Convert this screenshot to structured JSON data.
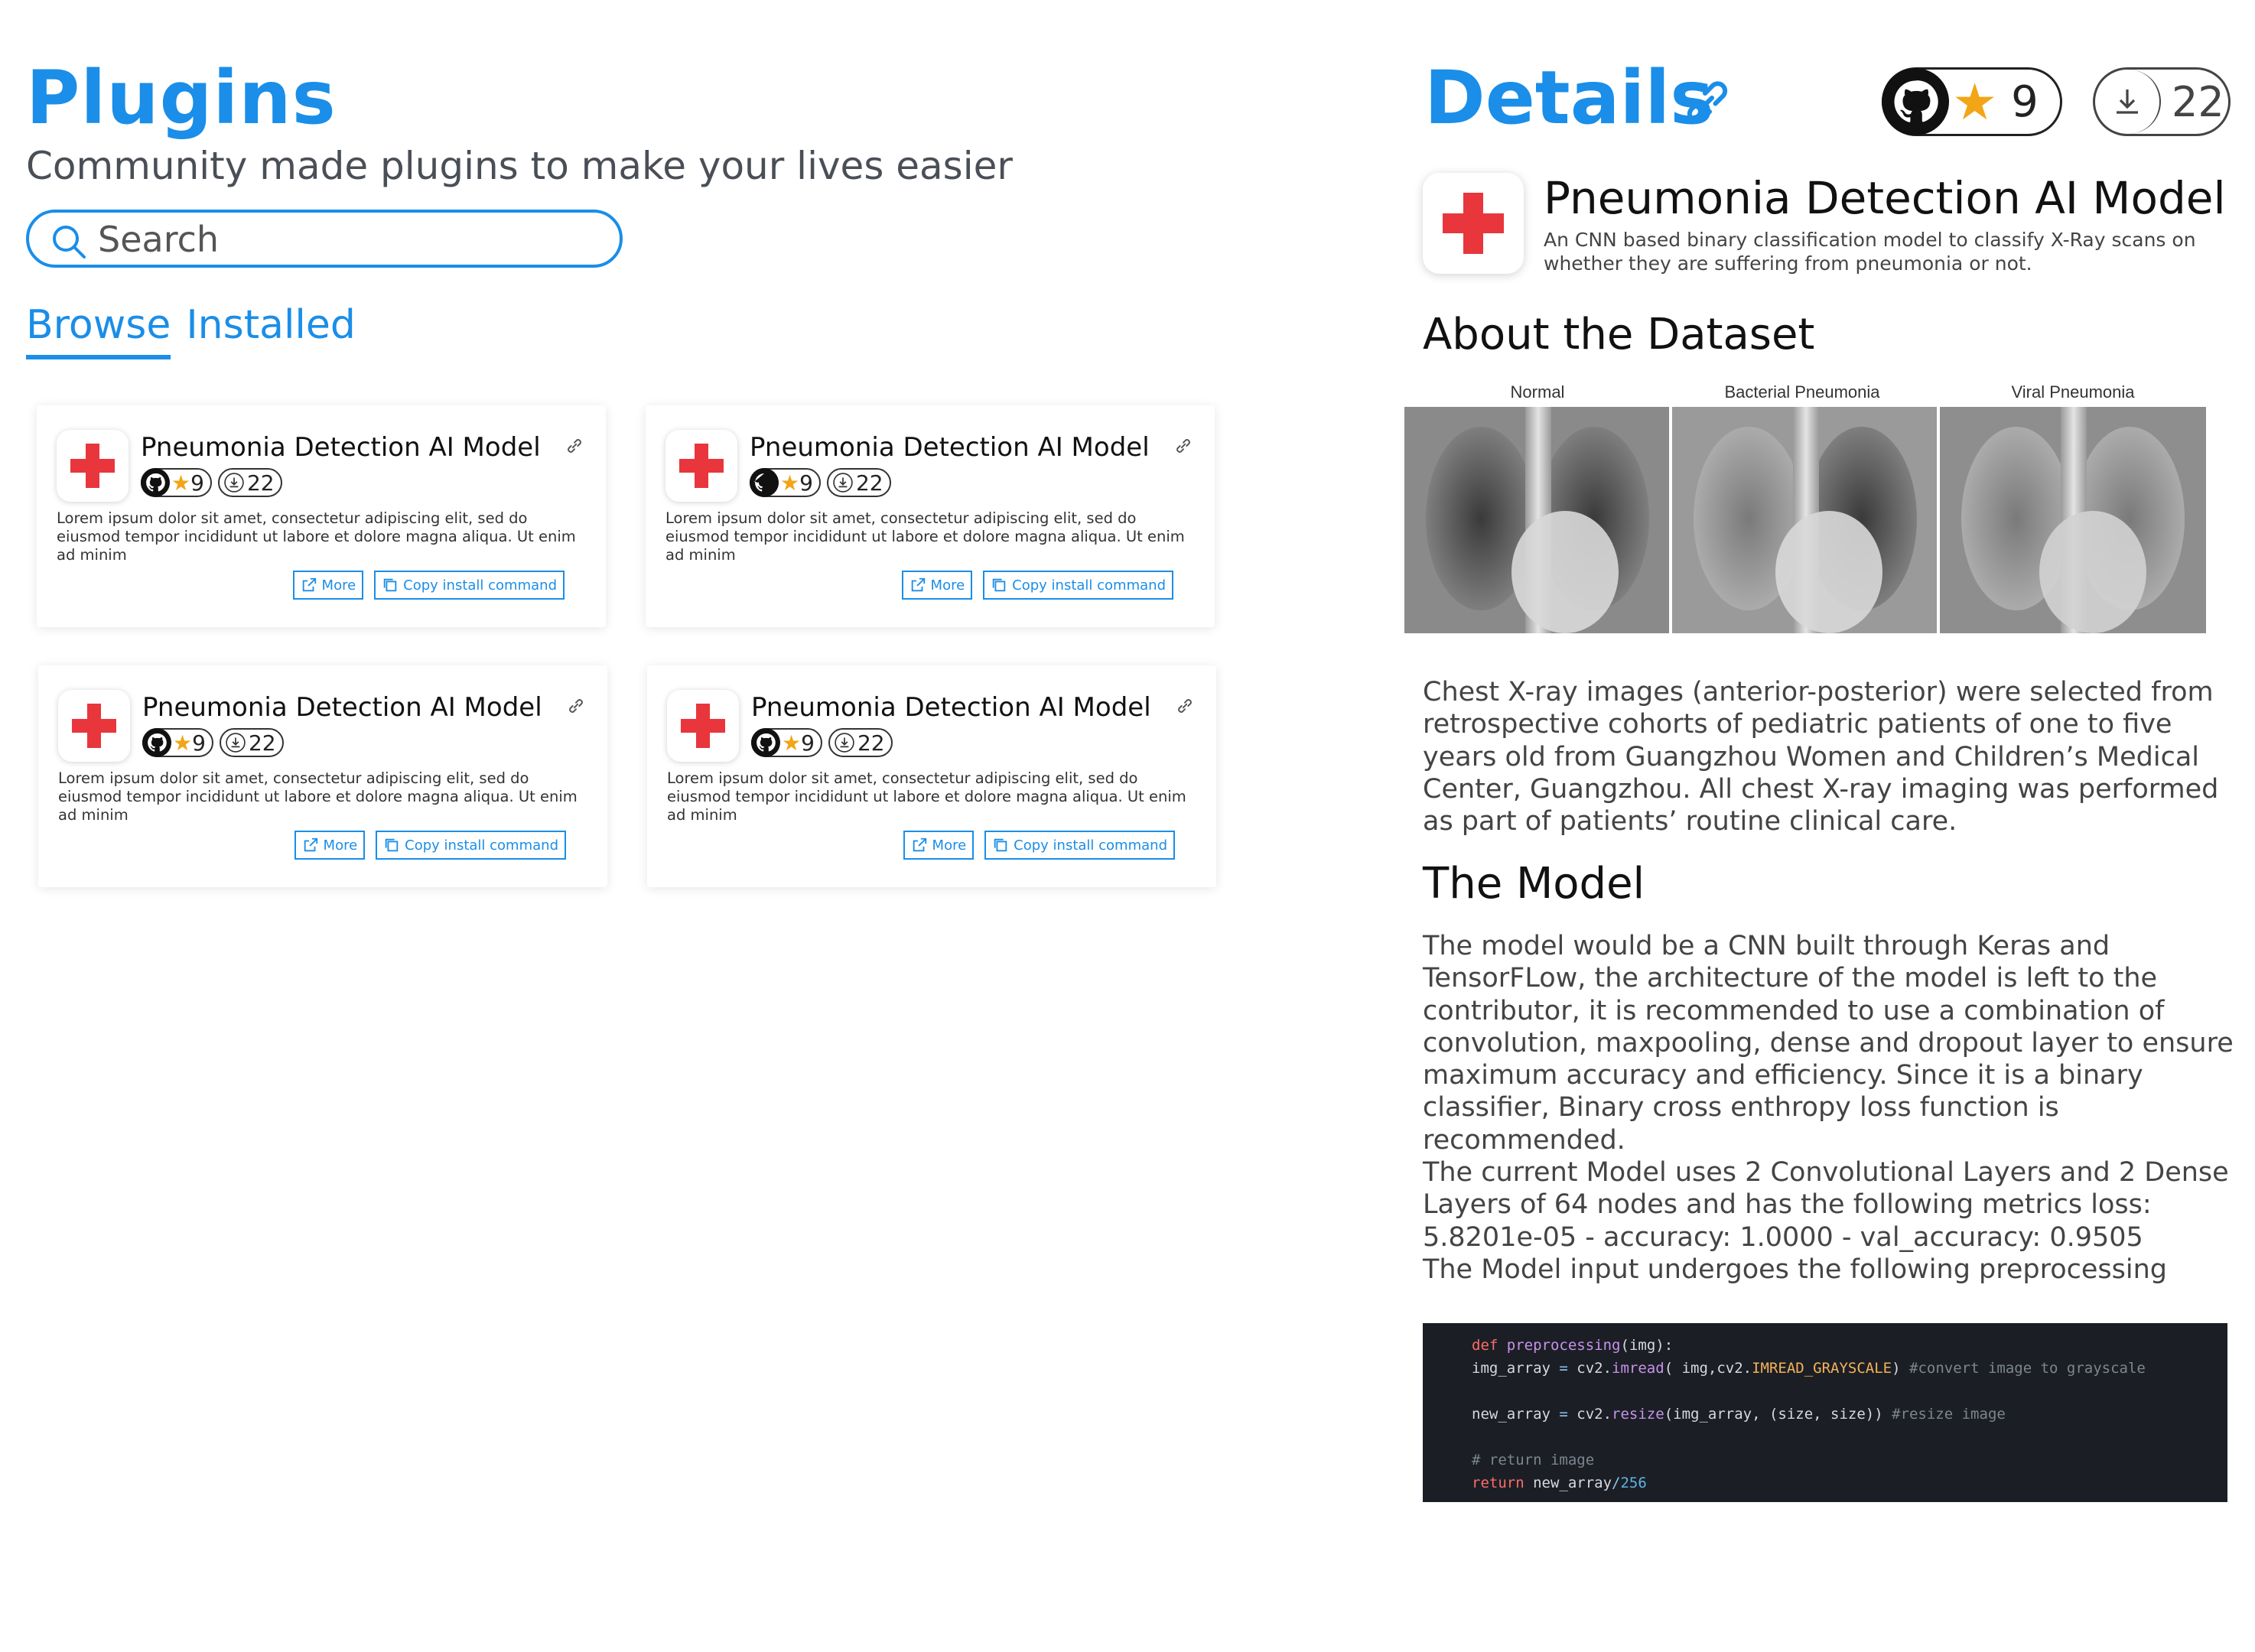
{
  "left": {
    "title": "Plugins",
    "subtitle": "Community made plugins to make your lives easier",
    "search": {
      "placeholder": "Search"
    },
    "tabs": [
      {
        "label": "Browse",
        "active": true
      },
      {
        "label": "Installed",
        "active": false
      }
    ],
    "cards": [
      {
        "title": "Pneumonia Detection AI Model",
        "stars": "9",
        "downloads": "22",
        "description": "Lorem ipsum dolor sit amet, consectetur adipiscing elit, sed do eiusmod tempor incididunt ut labore et dolore magna aliqua. Ut enim ad minim",
        "more_label": "More",
        "copy_label": "Copy install command"
      },
      {
        "title": "Pneumonia Detection AI Model",
        "stars": "9",
        "downloads": "22",
        "description": "Lorem ipsum dolor sit amet, consectetur adipiscing elit, sed do eiusmod tempor incididunt ut labore et dolore magna aliqua. Ut enim ad minim",
        "more_label": "More",
        "copy_label": "Copy install command"
      },
      {
        "title": "Pneumonia Detection AI Model",
        "stars": "9",
        "downloads": "22",
        "description": "Lorem ipsum dolor sit amet, consectetur adipiscing elit, sed do eiusmod tempor incididunt ut labore et dolore magna aliqua. Ut enim ad minim",
        "more_label": "More",
        "copy_label": "Copy install command"
      },
      {
        "title": "Pneumonia Detection AI Model",
        "stars": "9",
        "downloads": "22",
        "description": "Lorem ipsum dolor sit amet, consectetur adipiscing elit, sed do eiusmod tempor incididunt ut labore et dolore magna aliqua. Ut enim ad minim",
        "more_label": "More",
        "copy_label": "Copy install command"
      }
    ]
  },
  "details": {
    "title": "Details",
    "stars": "9",
    "downloads": "22",
    "model_title": "Pneumonia Detection AI Model",
    "model_subtitle": "An CNN based binary classification model to classify X-Ray scans on whether they are suffering from pneumonia or not.",
    "about_heading": "About the Dataset",
    "xray_labels": [
      "Normal",
      "Bacterial Pneumonia",
      "Viral Pneumonia"
    ],
    "about_text": "Chest X-ray images (anterior-posterior) were selected from retrospective cohorts of pediatric patients of one to five years old from Guangzhou Women and Children’s Medical Center, Guangzhou. All chest X-ray imaging was performed as part of patients’ routine clinical care.",
    "model_heading": "The Model",
    "model_text_1": "The model would be a CNN built through Keras and TensorFLow, the architecture of the model is left to the contributor, it is recommended to use a combination of convolution, maxpooling, dense and dropout layer to ensure maximum accuracy and efficiency. Since it is a binary classifier, Binary cross enthropy loss function is recommended.",
    "model_text_2": "The current Model uses 2 Convolutional Layers and 2 Dense Layers of 64 nodes and has the following metrics loss: 5.8201e-05 - accuracy: 1.0000 - val_accuracy: 0.9505",
    "model_text_3": "The Model input undergoes the following preprocessing",
    "code": {
      "l1_kw": "def",
      "l1_fn": "preprocessing",
      "l1_rest": "(img):",
      "l2_a": "img_array ",
      "l2_op": "=",
      "l2_b": " cv2.",
      "l2_fn": "imread",
      "l2_c": "( img,cv2.",
      "l2_const": "IMREAD_GRAYSCALE",
      "l2_d": ") ",
      "l2_cm": "#convert image to grayscale",
      "l3_a": "new_array ",
      "l3_op": "=",
      "l3_b": " cv2.",
      "l3_fn": "resize",
      "l3_c": "(img_array, (size, size)) ",
      "l3_cm": "#resize image",
      "l4_cm": "# return image",
      "l5_kw": "return",
      "l5_a": " new_array",
      "l5_op": "/",
      "l5_num": "256"
    }
  },
  "colors": {
    "accent": "#1a8ee8",
    "cross": "#e8363c",
    "star": "#f2a516",
    "code_bg": "#1b1f25"
  }
}
